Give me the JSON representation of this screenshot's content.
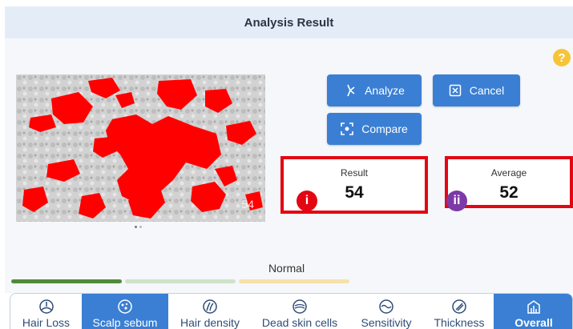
{
  "header": {
    "title": "Analysis Result"
  },
  "help": {
    "icon": "question-icon",
    "label": "?"
  },
  "image": {
    "overlay_value": "54",
    "highlight_color": "#ff0000",
    "carousel_dots": 2,
    "active_dot": 0
  },
  "actions": {
    "analyze_label": "Analyze",
    "cancel_label": "Cancel",
    "compare_label": "Compare"
  },
  "metrics": {
    "result": {
      "label": "Result",
      "value": "54",
      "marker": "i"
    },
    "average": {
      "label": "Average",
      "value": "52",
      "marker": "ii"
    }
  },
  "status": {
    "label": "Normal",
    "segments": [
      "#4f8a3a",
      "#cfe3c8",
      "#f6e2a8"
    ]
  },
  "tabs": [
    {
      "label": "Hair Loss",
      "icon": "hair-loss-icon",
      "active": false
    },
    {
      "label": "Scalp sebum",
      "icon": "scalp-sebum-icon",
      "active": true
    },
    {
      "label": "Hair density",
      "icon": "hair-density-icon",
      "active": false
    },
    {
      "label": "Dead skin cells",
      "icon": "dead-skin-icon",
      "active": false
    },
    {
      "label": "Sensitivity",
      "icon": "sensitivity-icon",
      "active": false
    },
    {
      "label": "Thickness",
      "icon": "thickness-icon",
      "active": false
    },
    {
      "label": "Overall",
      "icon": "overall-icon",
      "active": false
    }
  ],
  "colors": {
    "accent": "#3a7fd3",
    "highlight_border": "#e30613",
    "marker_ii": "#7b3aa8"
  }
}
